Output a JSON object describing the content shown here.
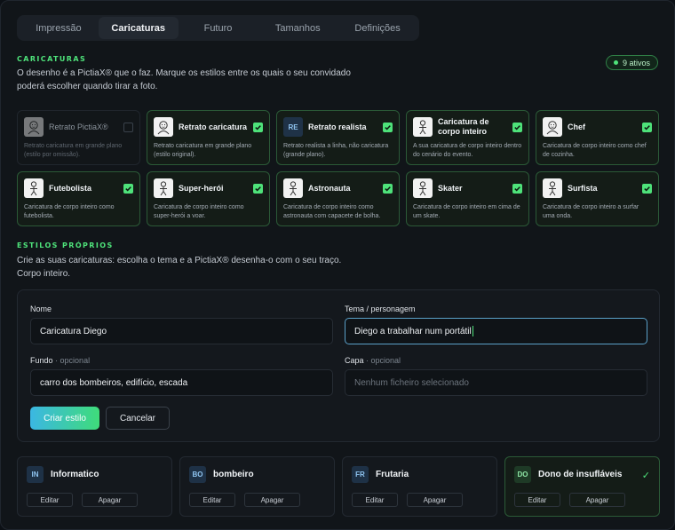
{
  "tabs": [
    "Impressão",
    "Caricaturas",
    "Futuro",
    "Tamanhos",
    "Definições"
  ],
  "caricaturas": {
    "heading": "CARICATURAS",
    "description_line1": "O desenho é a PictiaX® que o faz. Marque os estilos entre os quais o seu convidado",
    "description_line2": "poderá escolher quando tirar a foto.",
    "badge": "9 ativos",
    "styles": [
      {
        "title": "Retrato PictiaX®",
        "desc": "Retrato caricatura em grande plano (estilo por omissão).",
        "checked": false,
        "thumb": "portrait",
        "initials": ""
      },
      {
        "title": "Retrato caricatura",
        "desc": "Retrato caricatura em grande plano (estilo original).",
        "checked": true,
        "thumb": "portrait",
        "initials": ""
      },
      {
        "title": "Retrato realista",
        "desc": "Retrato realista a linha, não caricatura (grande plano).",
        "checked": true,
        "thumb": "initials",
        "initials": "RE"
      },
      {
        "title": "Caricatura de corpo inteiro",
        "desc": "A sua caricatura de corpo inteiro dentro do cenário do evento.",
        "checked": true,
        "thumb": "figure",
        "initials": ""
      },
      {
        "title": "Chef",
        "desc": "Caricatura de corpo inteiro como chef de cozinha.",
        "checked": true,
        "thumb": "portrait",
        "initials": ""
      },
      {
        "title": "Futebolista",
        "desc": "Caricatura de corpo inteiro como futebolista.",
        "checked": true,
        "thumb": "figure",
        "initials": ""
      },
      {
        "title": "Super-herói",
        "desc": "Caricatura de corpo inteiro como super-herói a voar.",
        "checked": true,
        "thumb": "figure",
        "initials": ""
      },
      {
        "title": "Astronauta",
        "desc": "Caricatura de corpo inteiro como astronauta com capacete de bolha.",
        "checked": true,
        "thumb": "figure",
        "initials": ""
      },
      {
        "title": "Skater",
        "desc": "Caricatura de corpo inteiro em cima de um skate.",
        "checked": true,
        "thumb": "figure",
        "initials": ""
      },
      {
        "title": "Surfista",
        "desc": "Caricatura de corpo inteiro a surfar uma onda.",
        "checked": true,
        "thumb": "figure",
        "initials": ""
      }
    ]
  },
  "proprios": {
    "heading": "ESTILOS PRÓPRIOS",
    "description_line1": "Crie as suas caricaturas: escolha o tema e a PictiaX® desenha-o com o seu traço.",
    "description_line2": "Corpo inteiro."
  },
  "form": {
    "name_label": "Nome",
    "name_value": "Caricatura Diego",
    "theme_label": "Tema / personagem",
    "theme_value": "Diego a trabalhar num portátil",
    "bg_label": "Fundo",
    "bg_optional": "· opcional",
    "bg_value": "carro dos bombeiros, edifício, escada",
    "cover_label": "Capa",
    "cover_optional": "· opcional",
    "cover_placeholder": "Nenhum ficheiro selecionado",
    "create_button": "Criar estilo",
    "cancel_button": "Cancelar"
  },
  "custom_styles": [
    {
      "initials": "IN",
      "name": "Informatico",
      "selected": false
    },
    {
      "initials": "BO",
      "name": "bombeiro",
      "selected": false
    },
    {
      "initials": "FR",
      "name": "Frutaria",
      "selected": false
    },
    {
      "initials": "DO",
      "name": "Dono de insufláveis",
      "selected": true
    }
  ],
  "custom_actions": {
    "edit": "Editar",
    "delete": "Apagar"
  },
  "colors": {
    "accent": "#4ee27a",
    "background": "#111519",
    "card_border_active": "#2b5a37"
  }
}
